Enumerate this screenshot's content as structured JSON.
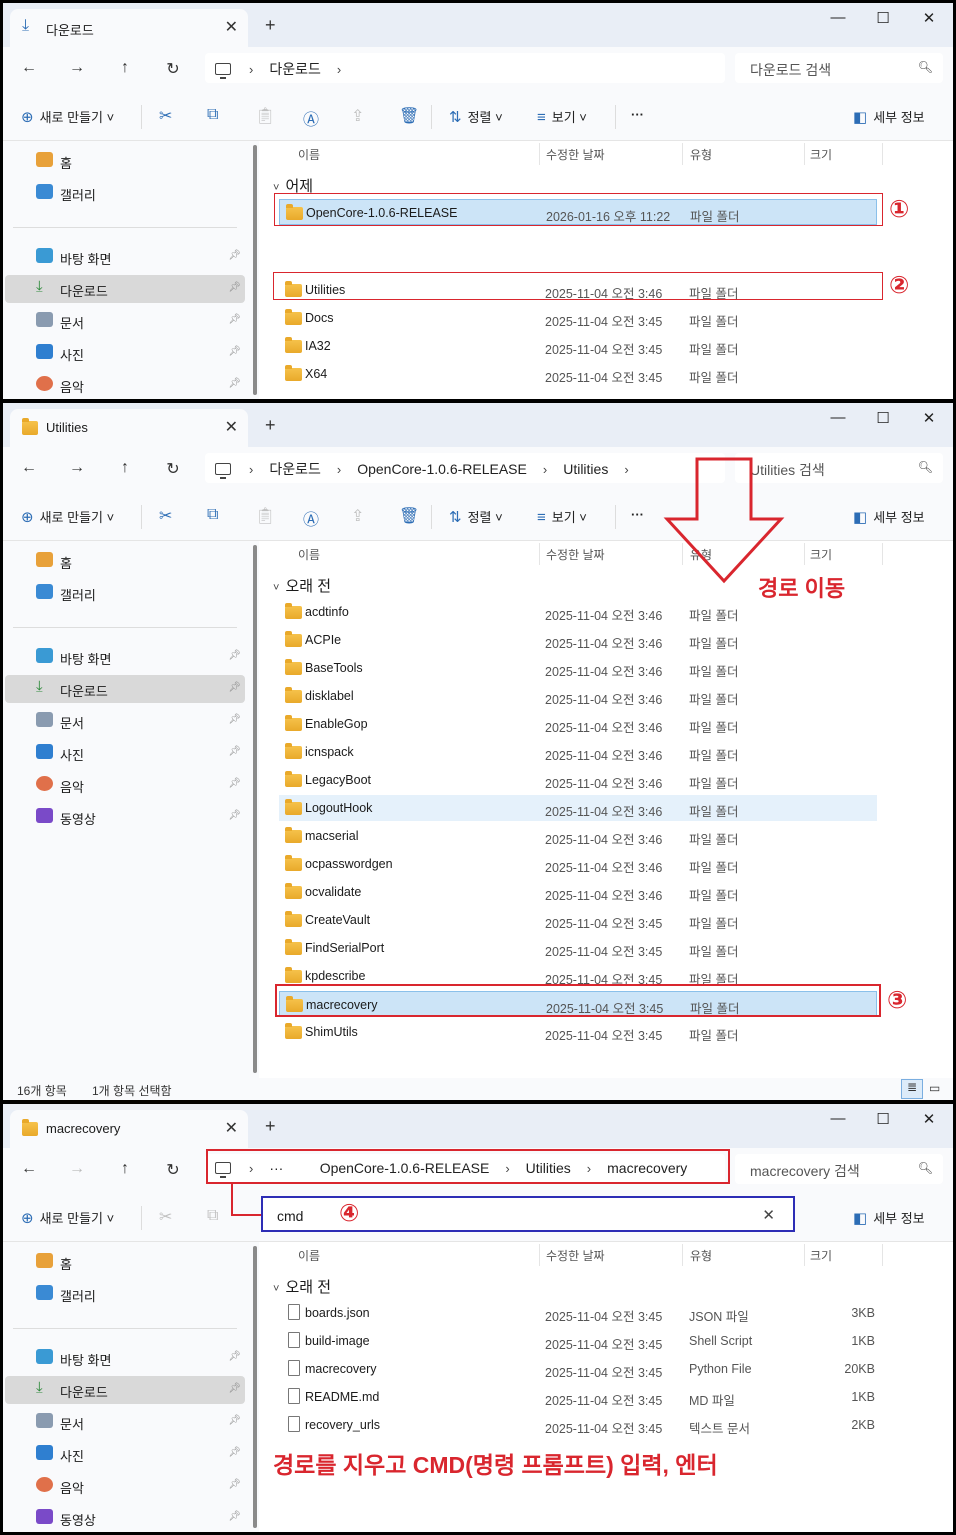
{
  "colors": {
    "accent": "#2d6db5",
    "annotation_red": "#d9262e",
    "annotation_blue": "#2d2db5",
    "selected_row": "#cce4f7"
  },
  "toolbar": {
    "new_label": "새로 만들기",
    "sort_label": "정렬",
    "view_label": "보기",
    "more_label": "···",
    "details_label": "세부 정보"
  },
  "nav": {
    "home": "홈",
    "gallery": "갤러리",
    "desktop": "바탕 화면",
    "downloads": "다운로드",
    "documents": "문서",
    "pictures": "사진",
    "music": "음악",
    "videos": "동영상"
  },
  "columns": {
    "name": "이름",
    "date": "수정한 날짜",
    "type": "유형",
    "size": "크기"
  },
  "panel1": {
    "tab_title": "다운로드",
    "breadcrumb": [
      "다운로드"
    ],
    "search_placeholder": "다운로드 검색",
    "group_yesterday": "어제",
    "rows_yesterday": [
      {
        "name": "OpenCore-1.0.6-RELEASE",
        "date": "2026-01-16 오후 11:22",
        "type": "파일 폴더"
      }
    ],
    "rows_older": [
      {
        "name": "Utilities",
        "date": "2025-11-04 오전 3:46",
        "type": "파일 폴더"
      },
      {
        "name": "Docs",
        "date": "2025-11-04 오전 3:45",
        "type": "파일 폴더"
      },
      {
        "name": "IA32",
        "date": "2025-11-04 오전 3:45",
        "type": "파일 폴더"
      },
      {
        "name": "X64",
        "date": "2025-11-04 오전 3:45",
        "type": "파일 폴더"
      }
    ],
    "mark1": "①",
    "mark2": "②"
  },
  "panel2": {
    "tab_title": "Utilities",
    "breadcrumb": [
      "다운로드",
      "OpenCore-1.0.6-RELEASE",
      "Utilities"
    ],
    "search_placeholder": "Utilities 검색",
    "group_older": "오래 전",
    "rows": [
      {
        "name": "acdtinfo",
        "date": "2025-11-04 오전 3:46",
        "type": "파일 폴더"
      },
      {
        "name": "ACPIe",
        "date": "2025-11-04 오전 3:46",
        "type": "파일 폴더"
      },
      {
        "name": "BaseTools",
        "date": "2025-11-04 오전 3:46",
        "type": "파일 폴더"
      },
      {
        "name": "disklabel",
        "date": "2025-11-04 오전 3:46",
        "type": "파일 폴더"
      },
      {
        "name": "EnableGop",
        "date": "2025-11-04 오전 3:46",
        "type": "파일 폴더"
      },
      {
        "name": "icnspack",
        "date": "2025-11-04 오전 3:46",
        "type": "파일 폴더"
      },
      {
        "name": "LegacyBoot",
        "date": "2025-11-04 오전 3:46",
        "type": "파일 폴더"
      },
      {
        "name": "LogoutHook",
        "date": "2025-11-04 오전 3:46",
        "type": "파일 폴더"
      },
      {
        "name": "macserial",
        "date": "2025-11-04 오전 3:46",
        "type": "파일 폴더"
      },
      {
        "name": "ocpasswordgen",
        "date": "2025-11-04 오전 3:46",
        "type": "파일 폴더"
      },
      {
        "name": "ocvalidate",
        "date": "2025-11-04 오전 3:46",
        "type": "파일 폴더"
      },
      {
        "name": "CreateVault",
        "date": "2025-11-04 오전 3:45",
        "type": "파일 폴더"
      },
      {
        "name": "FindSerialPort",
        "date": "2025-11-04 오전 3:45",
        "type": "파일 폴더"
      },
      {
        "name": "kpdescribe",
        "date": "2025-11-04 오전 3:45",
        "type": "파일 폴더"
      },
      {
        "name": "macrecovery",
        "date": "2025-11-04 오전 3:45",
        "type": "파일 폴더"
      },
      {
        "name": "ShimUtils",
        "date": "2025-11-04 오전 3:45",
        "type": "파일 폴더"
      }
    ],
    "status_count": "16개 항목",
    "status_selected": "1개 항목 선택함",
    "annotation": "경로 이동",
    "mark3": "③"
  },
  "panel3": {
    "tab_title": "macrecovery",
    "breadcrumb": [
      "···",
      "OpenCore-1.0.6-RELEASE",
      "Utilities",
      "macrecovery"
    ],
    "search_placeholder": "macrecovery 검색",
    "address_input": "cmd",
    "group_older": "오래 전",
    "rows": [
      {
        "name": "boards.json",
        "date": "2025-11-04 오전 3:45",
        "type": "JSON 파일",
        "size": "3KB"
      },
      {
        "name": "build-image",
        "date": "2025-11-04 오전 3:45",
        "type": "Shell Script",
        "size": "1KB"
      },
      {
        "name": "macrecovery",
        "date": "2025-11-04 오전 3:45",
        "type": "Python File",
        "size": "20KB"
      },
      {
        "name": "README.md",
        "date": "2025-11-04 오전 3:45",
        "type": "MD 파일",
        "size": "1KB"
      },
      {
        "name": "recovery_urls",
        "date": "2025-11-04 오전 3:45",
        "type": "텍스트 문서",
        "size": "2KB"
      }
    ],
    "annotation": "경로를 지우고 CMD(명령 프롬프트) 입력, 엔터",
    "mark4": "④"
  }
}
